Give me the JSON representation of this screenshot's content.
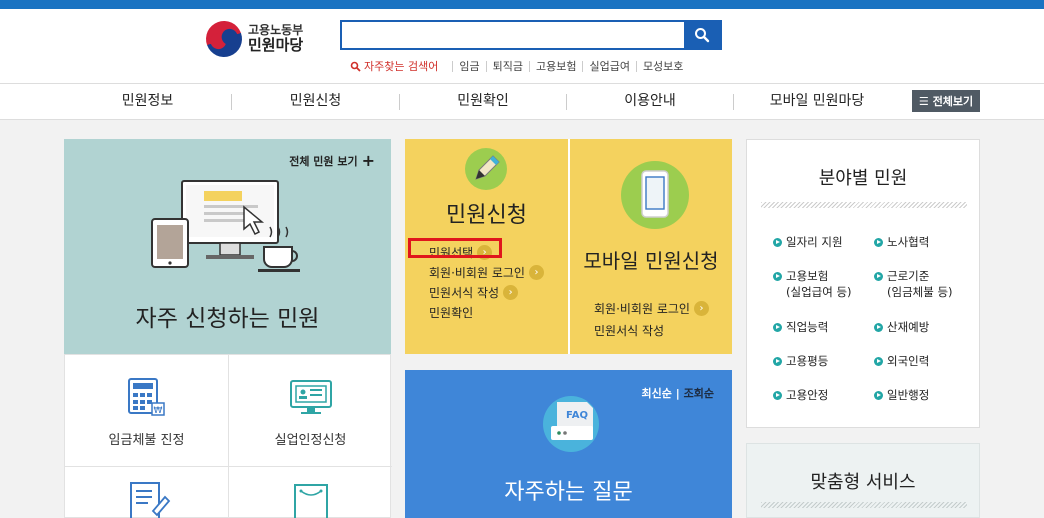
{
  "header": {
    "logo_sub": "고용노동부",
    "logo_main": "민원마당",
    "search": {
      "value": "",
      "placeholder": ""
    },
    "keywords_title": "자주찾는 검색어",
    "keywords": [
      "임금",
      "퇴직금",
      "고용보험",
      "실업급여",
      "모성보호"
    ]
  },
  "nav": {
    "items": [
      "민원정보",
      "민원신청",
      "민원확인",
      "이용안내",
      "모바일 민원마당"
    ],
    "all_label": "전체보기"
  },
  "frequent": {
    "all_link": "전체 민원 보기",
    "title": "자주 신청하는 민원",
    "items": [
      "임금체불 진정",
      "실업인정신청"
    ]
  },
  "apply": {
    "title": "민원신청",
    "links": [
      "민원선택",
      "회원·비회원 로그인",
      "민원서식 작성",
      "민원확인"
    ]
  },
  "mobile": {
    "title": "모바일 민원신청",
    "links": [
      "회원·비회원 로그인",
      "민원서식 작성"
    ]
  },
  "faq": {
    "sort_latest": "최신순",
    "sort_sep": "|",
    "sort_views": "조회순",
    "icon_text": "FAQ",
    "title": "자주하는 질문"
  },
  "field": {
    "title": "분야별 민원",
    "items": [
      {
        "l1": "일자리 지원",
        "l2": ""
      },
      {
        "l1": "노사협력",
        "l2": ""
      },
      {
        "l1": "고용보험",
        "l2": "(실업급여 등)"
      },
      {
        "l1": "근로기준",
        "l2": "(임금체불 등)"
      },
      {
        "l1": "직업능력",
        "l2": ""
      },
      {
        "l1": "산재예방",
        "l2": ""
      },
      {
        "l1": "고용평등",
        "l2": ""
      },
      {
        "l1": "외국인력",
        "l2": ""
      },
      {
        "l1": "고용안정",
        "l2": ""
      },
      {
        "l1": "일반행정",
        "l2": ""
      }
    ]
  },
  "custom": {
    "title": "맞춤형 서비스"
  },
  "colors": {
    "brand_blue": "#1a5fb4",
    "apply_yellow": "#f4d25e",
    "frequent_teal": "#b1d3d2",
    "faq_blue": "#3f86d8",
    "highlight_red": "#e0161c"
  }
}
